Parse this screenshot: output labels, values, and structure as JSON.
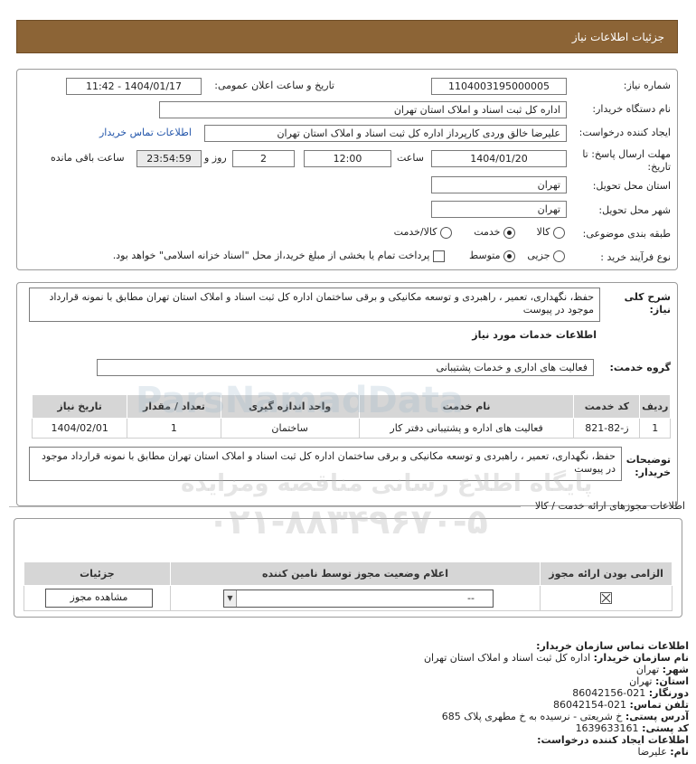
{
  "header": {
    "title": "جزئیات اطلاعات نیاز"
  },
  "form": {
    "need_number_label": "شماره نیاز:",
    "need_number": "1104003195000005",
    "announce_label": "تاریخ و ساعت اعلان عمومی:",
    "announce_value": "1404/01/17 - 11:42",
    "buyer_org_label": "نام دستگاه خریدار:",
    "buyer_org": "اداره کل ثبت اسناد و املاک استان تهران",
    "requester_label": "ایجاد کننده درخواست:",
    "requester": "علیرضا خالق وردی کارپرداز اداره کل ثبت اسناد و املاک استان تهران",
    "contact_link": "اطلاعات تماس خریدار",
    "deadline_label": "مهلت ارسال پاسخ: تا تاریخ:",
    "deadline_date": "1404/01/20",
    "time_label": "ساعت",
    "deadline_time": "12:00",
    "days": "2",
    "days_label": "روز و",
    "remaining": "23:54:59",
    "remaining_label": "ساعت باقی مانده",
    "province_label": "استان محل تحویل:",
    "province": "تهران",
    "city_label": "شهر محل تحویل:",
    "city": "تهران",
    "category_label": "طبقه بندی موضوعی:",
    "category_options": [
      "کالا",
      "خدمت",
      "کالا/خدمت"
    ],
    "category_selected": "خدمت",
    "process_label": "نوع فرآیند خرید :",
    "process_options": [
      "جزیی",
      "متوسط"
    ],
    "process_selected": "متوسط",
    "payment_note": "پرداخت تمام یا بخشی از مبلغ خرید،از محل \"اسناد خزانه اسلامی\" خواهد بود."
  },
  "description": {
    "label": "شرح کلی نیاز:",
    "text": "حفظ، نگهداری، تعمیر ، راهبردی و توسعه مکانیکی و برقی ساختمان اداره کل ثبت اسناد و املاک استان تهران مطابق با نمونه قرارداد موجود در پیوست"
  },
  "services": {
    "section_title": "اطلاعات خدمات مورد نیاز",
    "group_label": "گروه خدمت:",
    "group_value": "فعالیت های اداری و خدمات پشتیبانی",
    "columns": [
      "ردیف",
      "کد خدمت",
      "نام خدمت",
      "واحد اندازه گیری",
      "تعداد / مقدار",
      "تاریخ نیاز"
    ],
    "rows": [
      {
        "row": "1",
        "code": "ز-82-821",
        "name": "فعالیت های اداره و پشتیبانی دفتر کار",
        "unit": "ساختمان",
        "qty": "1",
        "date": "1404/02/01"
      }
    ]
  },
  "buyer_notes": {
    "label": "توضیحات خریدار:",
    "text": "حفظ، نگهداری، تعمیر ، راهبردی و توسعه مکانیکی و برقی ساختمان اداره کل ثبت اسناد و املاک استان تهران مطابق با نمونه قرارداد موجود در پیوست"
  },
  "permits": {
    "section_title": "اطلاعات مجوزهای ارائه خدمت / کالا",
    "columns": [
      "الزامی بودن ارائه مجوز",
      "اعلام وضعیت مجوز توسط نامین کننده",
      "جزئیات"
    ],
    "status_value": "--",
    "view_button": "مشاهده مجوز"
  },
  "contact": {
    "title": "اطلاعات تماس سازمان خریدار:",
    "org_label": "نام سازمان خریدار:",
    "org": "اداره کل ثبت اسناد و املاک استان تهران",
    "city_label": "شهر:",
    "city": "تهران",
    "province_label": "استان:",
    "province": "تهران",
    "fax_label": "دورنگار:",
    "fax": "021-86042156",
    "phone_label": "تلفن تماس:",
    "phone": "021-86042154",
    "address_label": "آدرس پستی:",
    "address": "خ شریعتی - نرسیده به خ مطهری پلاک 685",
    "postal_label": "کد پستی:",
    "postal": "1639633161",
    "creator_title": "اطلاعات ایجاد کننده درخواست:",
    "name_label": "نام:",
    "name": "علیرضا"
  },
  "watermark": {
    "phone": "۰۲۱-۸۸۳۴۹۶۷۰-۵",
    "site": "ParsNamadData",
    "tagline": "پایگاه اطلاع رسانی مناقصه ومزایده"
  }
}
